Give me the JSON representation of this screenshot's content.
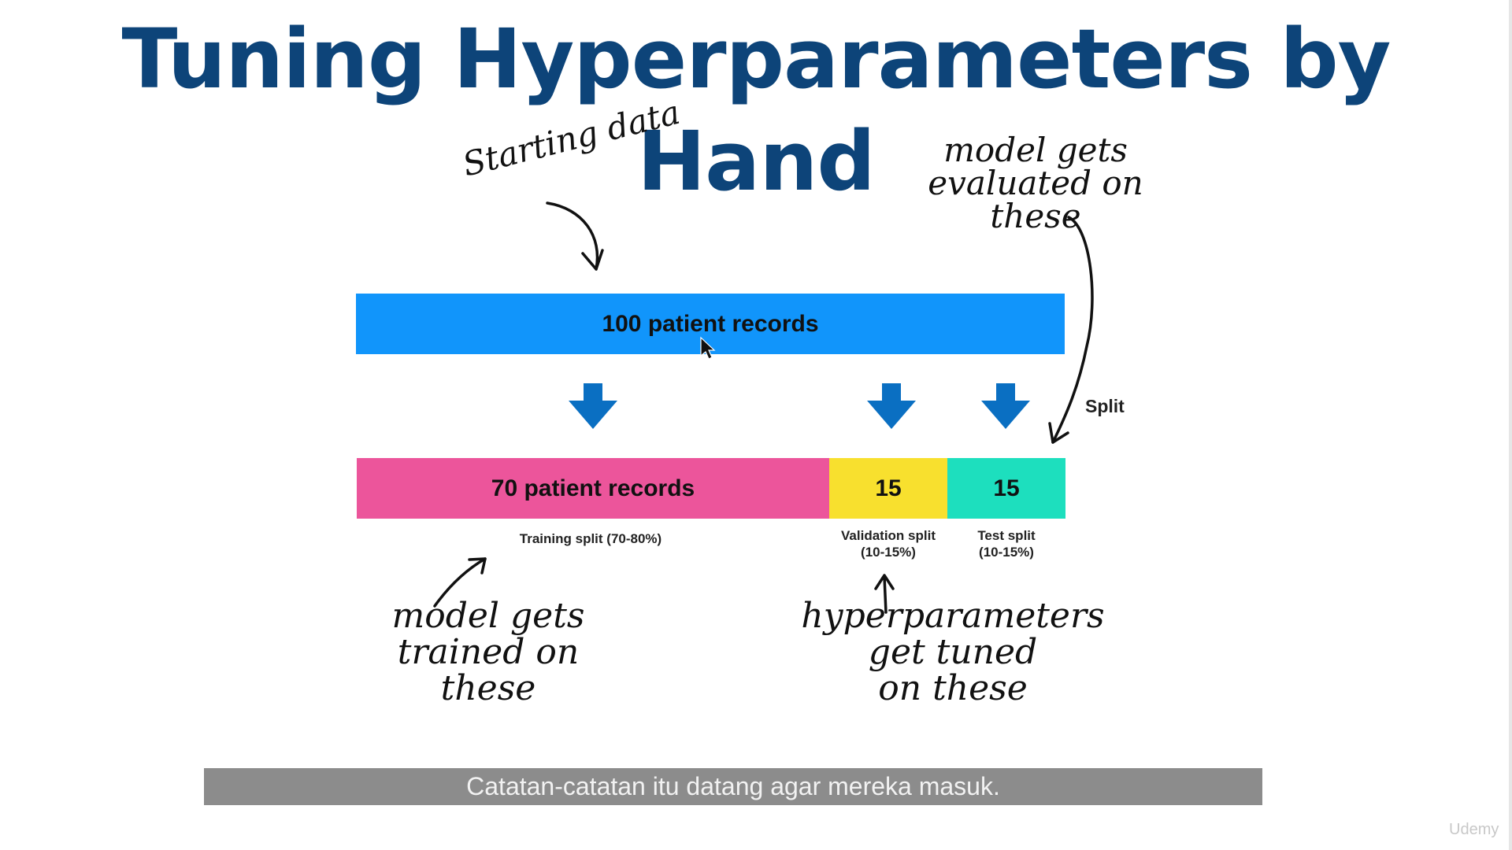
{
  "slide": {
    "title": "Tuning Hyperparameters by Hand",
    "colors": {
      "title": "#0d4479",
      "total_bar": "#1195fb",
      "train_bar": "#ec559b",
      "validation_bar": "#f8e02e",
      "test_bar": "#1ddfbe",
      "arrow": "#0a6fc2"
    }
  },
  "bars": {
    "total": "100 patient records",
    "train": "70 patient records",
    "validation": "15",
    "test": "15"
  },
  "captions": {
    "train": "Training split (70-80%)",
    "validation_line1": "Validation split",
    "validation_line2": "(10-15%)",
    "test_line1": "Test split",
    "test_line2": "(10-15%)",
    "split": "Split"
  },
  "handwriting": {
    "starting": "Starting data",
    "evaluated": "model gets\nevaluated on\nthese",
    "trained": "model gets\ntrained on\nthese",
    "hyper": "hyperparameters\nget tuned\non these"
  },
  "subtitle": "Catatan-catatan itu datang agar mereka masuk.",
  "logo": "Udemy",
  "icons": [
    "down-arrow-icon",
    "mouse-cursor-icon",
    "hand-drawn-arrow-icon"
  ]
}
